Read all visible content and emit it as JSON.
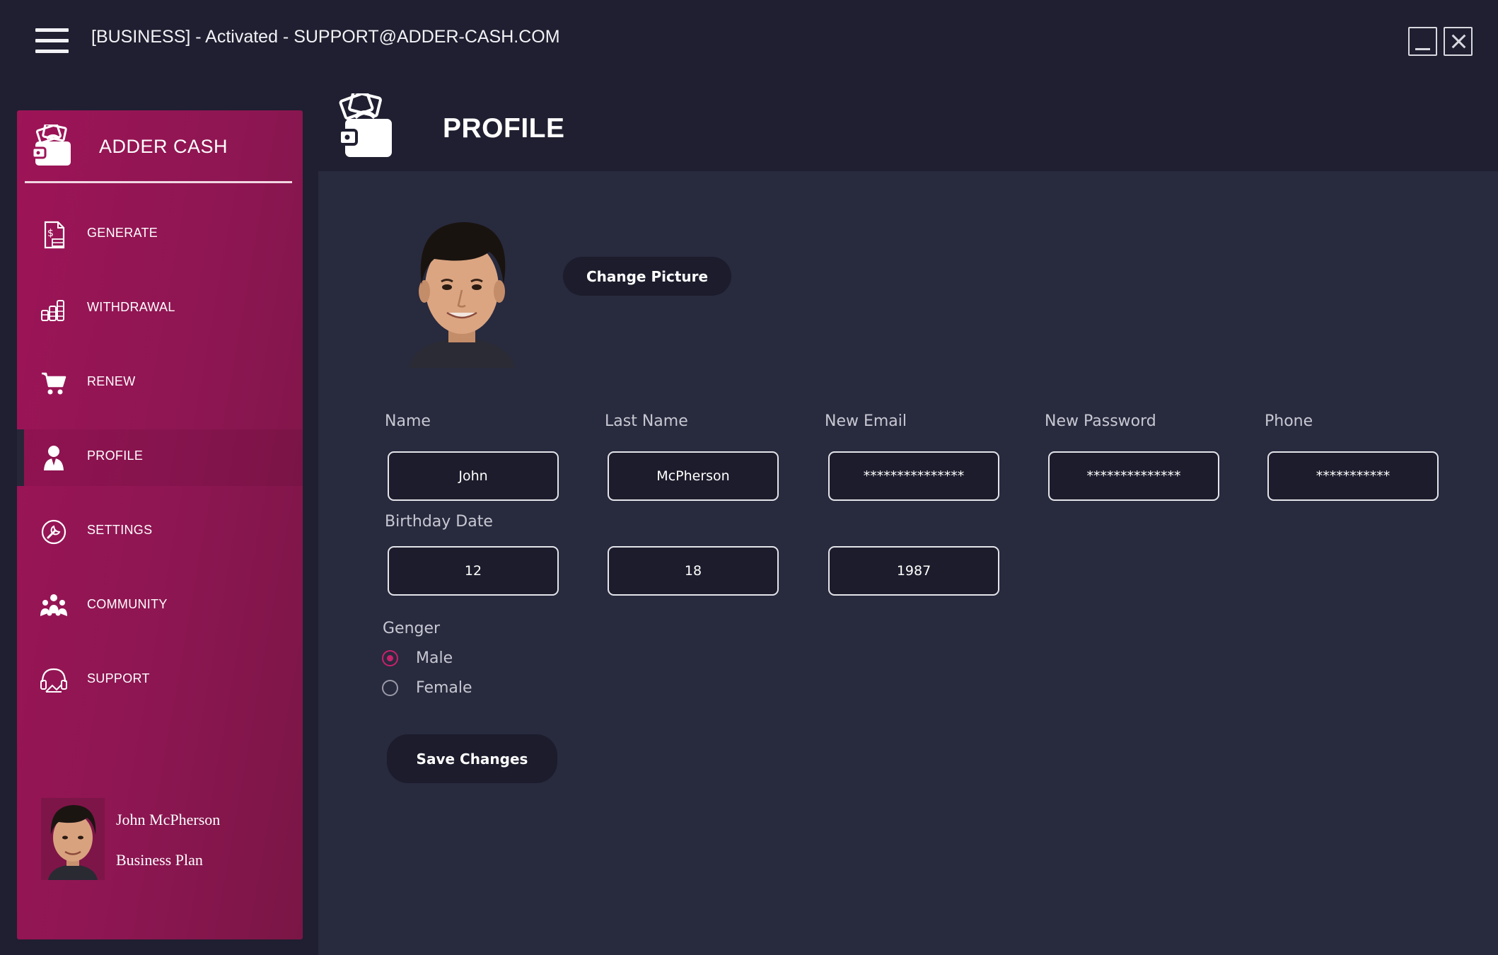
{
  "window": {
    "title": "[BUSINESS] - Activated - SUPPORT@ADDER-CASH.COM"
  },
  "sidebar": {
    "brand": "ADDER CASH",
    "items": [
      {
        "label": "GENERATE",
        "icon": "invoice-icon"
      },
      {
        "label": "WITHDRAWAL",
        "icon": "coins-icon"
      },
      {
        "label": "RENEW",
        "icon": "cart-icon"
      },
      {
        "label": "PROFILE",
        "icon": "user-icon",
        "active": true
      },
      {
        "label": "SETTINGS",
        "icon": "wrench-icon"
      },
      {
        "label": "COMMUNITY",
        "icon": "group-icon"
      },
      {
        "label": "SUPPORT",
        "icon": "support-icon"
      }
    ],
    "user": {
      "name": "John McPherson",
      "plan": "Business Plan"
    }
  },
  "page": {
    "title": "PROFILE"
  },
  "profile": {
    "change_picture_label": "Change Picture",
    "fields": {
      "name": {
        "label": "Name",
        "value": "John"
      },
      "last_name": {
        "label": "Last Name",
        "value": "McPherson"
      },
      "new_email": {
        "label": "New Email",
        "value": "***************"
      },
      "new_password": {
        "label": "New Password",
        "value": "**************"
      },
      "phone": {
        "label": "Phone",
        "value": "***********"
      }
    },
    "birthday": {
      "label": "Birthday Date",
      "month": "12",
      "day": "18",
      "year": "1987"
    },
    "gender": {
      "label": "Genger",
      "options": [
        "Male",
        "Female"
      ],
      "selected": "Male"
    },
    "save_label": "Save Changes"
  },
  "colors": {
    "background": "#1f1f31",
    "panel": "#282a3e",
    "sidebar": "#8d1652",
    "accent": "#c7226a",
    "field": "#1c1c2c"
  }
}
